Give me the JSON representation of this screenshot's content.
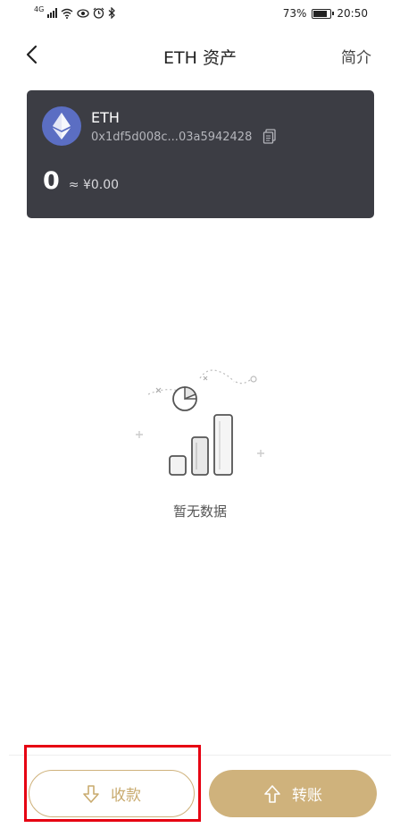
{
  "status_bar": {
    "network": "4G",
    "battery": "73%",
    "battery_level": 0.73,
    "time": "20:50"
  },
  "header": {
    "title": "ETH 资产",
    "intro": "简介"
  },
  "asset": {
    "coin": "ETH",
    "address": "0x1df5d008c...03a5942428",
    "balance": "0",
    "fiat": "≈ ¥0.00"
  },
  "empty_state": {
    "text": "暂无数据"
  },
  "actions": {
    "receive": "收款",
    "transfer": "转账"
  },
  "colors": {
    "card_bg": "#3c3d44",
    "accent_gold": "#cfb27c",
    "eth_logo": "#5b6ec3",
    "highlight": "#e60012"
  }
}
